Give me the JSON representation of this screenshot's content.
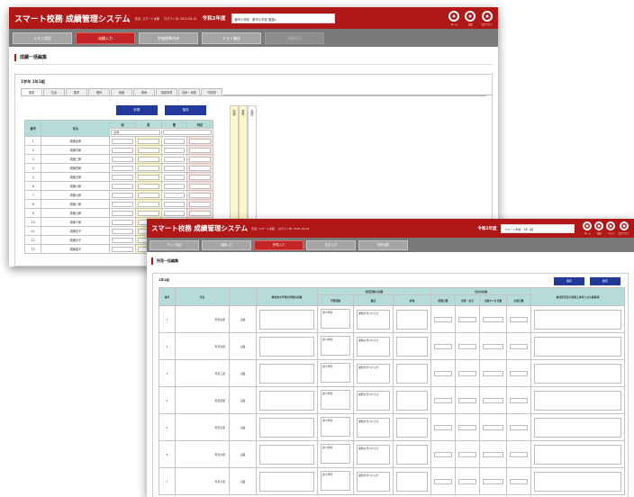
{
  "header": {
    "app_title": "スマート校務 成績管理システム",
    "meta": [
      "氏名: スマート太郎",
      "ログイン中: 2021-04-01"
    ],
    "year": "令和2年度",
    "school_select_back": "都市小学校　都市小学校 国語A",
    "school_select_front": "スマート学校　1年 1組",
    "icons": [
      {
        "label": "ホーム",
        "icon": "home-icon"
      },
      {
        "label": "設定",
        "icon": "gear-icon"
      },
      {
        "label": "ヘルプ",
        "icon": "help-icon"
      },
      {
        "label": "ログアウト",
        "icon": "logout-icon"
      }
    ]
  },
  "back_window": {
    "nav": [
      "テスト設定",
      "成績入力",
      "評価規準作成",
      "テスト確認",
      "成績出力"
    ],
    "page_title": "成績一括編集",
    "section_title": "1学年 1年1組",
    "subject_tabs": [
      "国語",
      "社会",
      "数学",
      "理科",
      "音楽",
      "美術",
      "保健体育",
      "技術・家庭",
      "外国語"
    ],
    "buttons": {
      "calc": "計算",
      "save": "保存"
    },
    "columns": {
      "no": "番号",
      "name": "氏名",
      "c1": "知",
      "c2": "思",
      "c3": "態",
      "score": "評定"
    },
    "filter": "全体",
    "rows": [
      {
        "no": "1",
        "name": "成績太郎"
      },
      {
        "no": "2",
        "name": "成績次郎"
      },
      {
        "no": "3",
        "name": "成績三郎"
      },
      {
        "no": "4",
        "name": "成績四郎"
      },
      {
        "no": "5",
        "name": "成績五郎"
      },
      {
        "no": "6",
        "name": "成績六郎"
      },
      {
        "no": "7",
        "name": "成績七郎"
      },
      {
        "no": "8",
        "name": "成績八郎"
      },
      {
        "no": "9",
        "name": "成績九郎"
      },
      {
        "no": "10",
        "name": "成績十郎"
      },
      {
        "no": "11",
        "name": "成績花子"
      },
      {
        "no": "12",
        "name": "成績月子"
      },
      {
        "no": "13",
        "name": "成績星子"
      }
    ],
    "side_labels": [
      "知識",
      "思考",
      "態度"
    ]
  },
  "front_window": {
    "nav": [
      "テスト設定",
      "成績入力",
      "所見入力",
      "出欠入力",
      "特別活動"
    ],
    "page_title": "所見一括編集",
    "section_title": "1年1組",
    "buttons": {
      "calc": "保存",
      "save": "確定"
    },
    "columns": {
      "no": "番号",
      "name": "氏名",
      "remarks": "総合的な学習の時間の記録",
      "activity_group": "特別活動の記録",
      "activity": "学習活動",
      "view": "観点",
      "eval": "評価",
      "attendance_group": "出欠の記録",
      "a1": "授業日数",
      "a2": "出停・忌引",
      "a3": "出席すべき日数",
      "a4": "欠席日数",
      "note": "総合所見及び指導上参考となる諸事項"
    },
    "rows": [
      {
        "no": "1",
        "name": "所見太郎",
        "status": "記載"
      },
      {
        "no": "2",
        "name": "所見次郎",
        "status": "記載"
      },
      {
        "no": "3",
        "name": "所見三郎",
        "status": "記載"
      },
      {
        "no": "4",
        "name": "所見四郎",
        "status": "記載"
      },
      {
        "no": "5",
        "name": "所見五郎",
        "status": "記載"
      },
      {
        "no": "6",
        "name": "所見六郎",
        "status": "記載"
      },
      {
        "no": "7",
        "name": "所見七郎",
        "status": "記載"
      }
    ],
    "cell_text": {
      "activity": "調べ学習",
      "view": "課題を見つける力"
    }
  },
  "colors": {
    "brand_red": "#b01818",
    "nav_gray": "#7a7a7a",
    "header_teal": "#b5dcd9",
    "button_blue": "#22389a"
  }
}
